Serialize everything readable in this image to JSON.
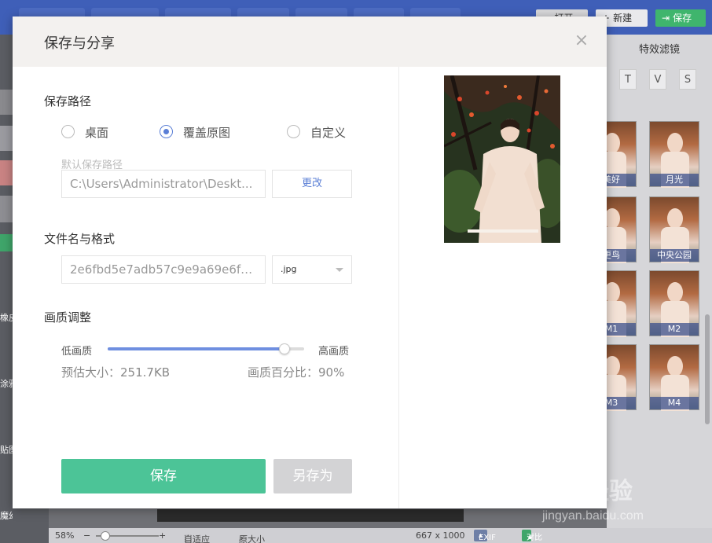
{
  "app": {
    "toolbar": {
      "open_label": "打开",
      "new_label": "新建",
      "save_label": "保存"
    },
    "left_tools": [
      "橡皮",
      "涂鸦",
      "贴图",
      "魔幻笔"
    ],
    "right_panel": {
      "title": "特效滤镜",
      "tabs": [
        "T",
        "V",
        "S"
      ],
      "thumbnails": [
        "美好",
        "月光",
        "更鸟",
        "中央公园",
        "M1",
        "M2",
        "M3",
        "M4"
      ]
    },
    "status": {
      "zoom": "58%",
      "fit_label": "自适应",
      "original_label": "原大小",
      "image_size": "667 x 1000",
      "exif_label": "EXIF",
      "compare_label": "对比"
    },
    "watermark": "Bai 经验",
    "watermark_url": "jingyan.baidu.com"
  },
  "dialog": {
    "title": "保存与分享",
    "close_icon": "×",
    "save_path": {
      "title": "保存路径",
      "options": [
        {
          "label": "桌面",
          "selected": false
        },
        {
          "label": "覆盖原图",
          "selected": true
        },
        {
          "label": "自定义",
          "selected": false
        }
      ],
      "default_path_label": "默认保存路径",
      "path_value": "C:\\Users\\Administrator\\Deskt...",
      "change_label": "更改"
    },
    "file": {
      "title": "文件名与格式",
      "filename": "2e6fbd5e7adb57c9e9a69e6fcb...",
      "format": ".jpg"
    },
    "quality": {
      "title": "画质调整",
      "low_label": "低画质",
      "high_label": "高画质",
      "percent": 90,
      "estimated_size": "预估大小：251.7KB",
      "percent_text": "画质百分比：90%"
    },
    "actions": {
      "save_label": "保存",
      "save_as_label": "另存为"
    }
  },
  "colors": {
    "primary_green": "#4cc497",
    "accent_blue": "#5b7fd6",
    "header_bg": "#f3f1ef"
  }
}
